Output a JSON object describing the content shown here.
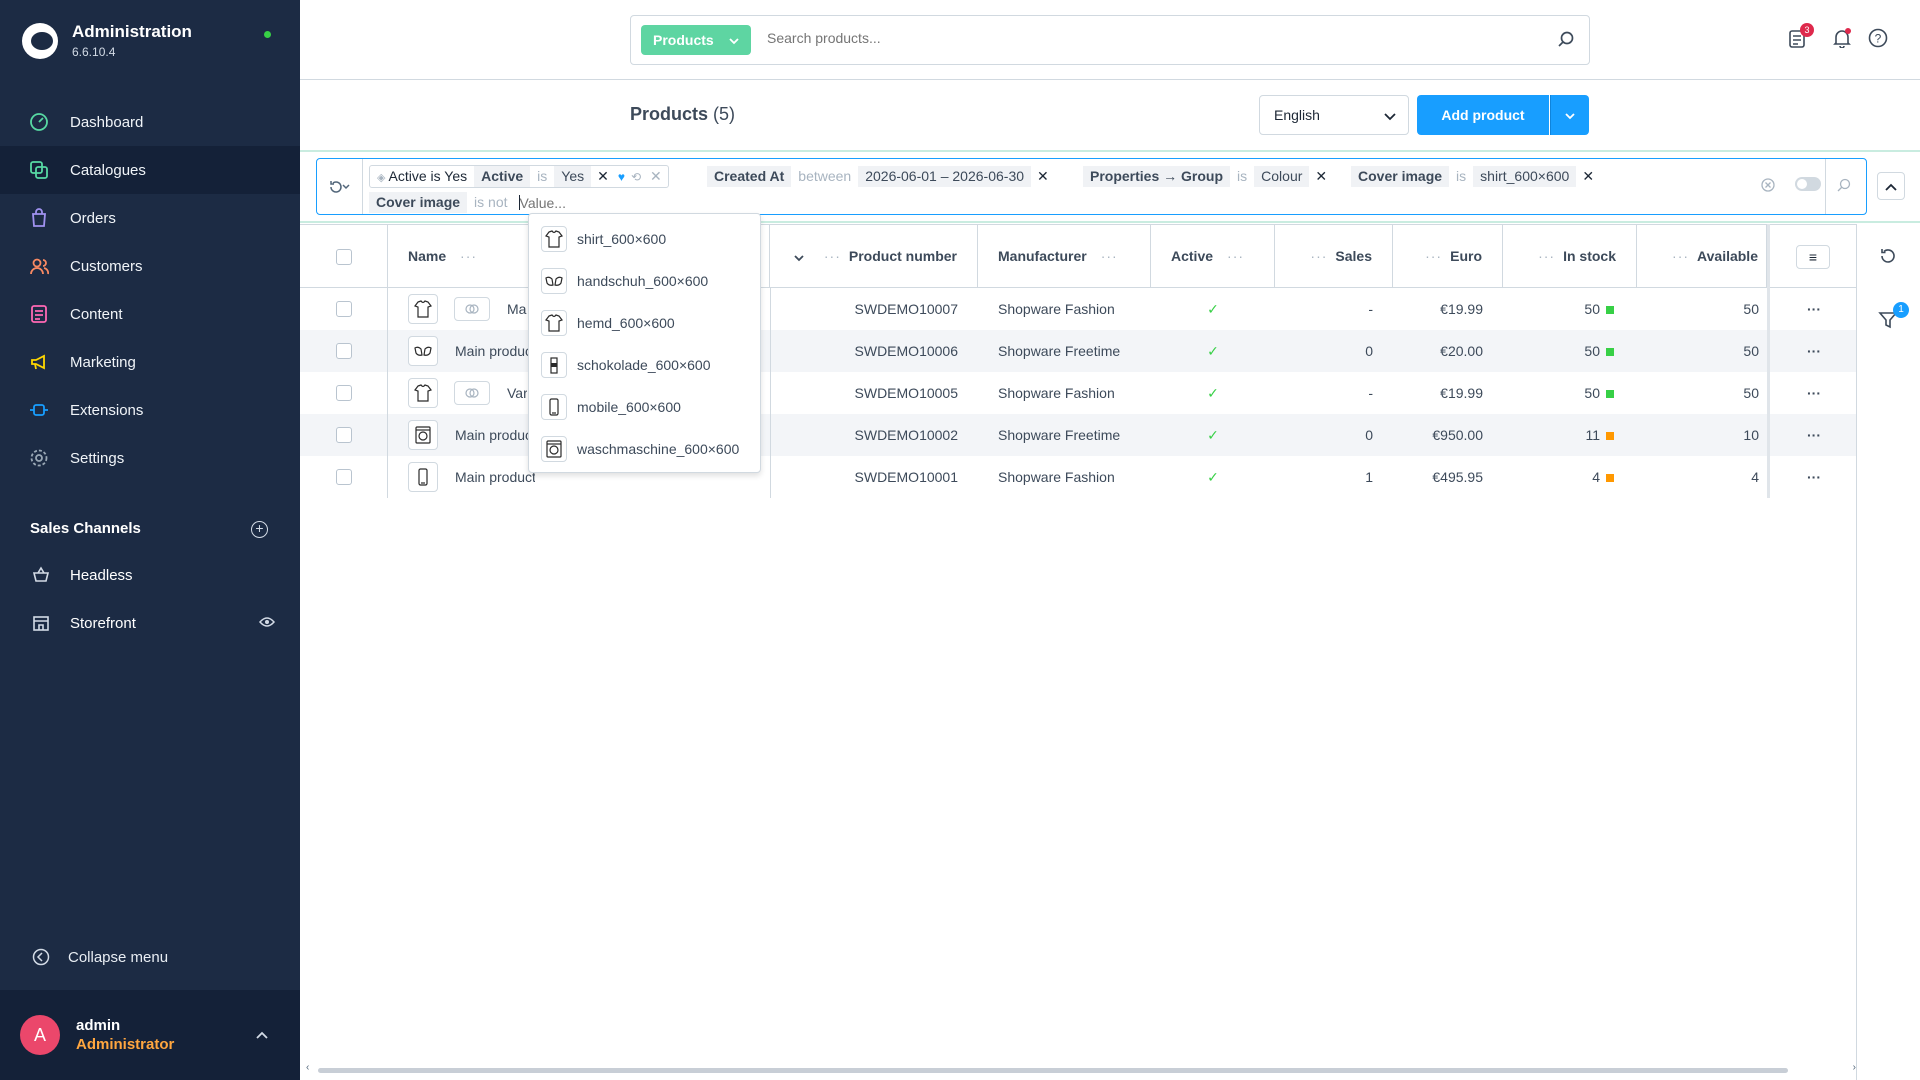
{
  "app": {
    "title": "Administration",
    "version": "6.6.10.4"
  },
  "sidebar": {
    "items": [
      {
        "label": "Dashboard",
        "icon": "dashboard-icon",
        "color": "#57d9a3"
      },
      {
        "label": "Catalogues",
        "icon": "catalogue-icon",
        "color": "#57d9a3",
        "active": true
      },
      {
        "label": "Orders",
        "icon": "orders-icon",
        "color": "#a092f0"
      },
      {
        "label": "Customers",
        "icon": "customers-icon",
        "color": "#f88962"
      },
      {
        "label": "Content",
        "icon": "content-icon",
        "color": "#ff68b4"
      },
      {
        "label": "Marketing",
        "icon": "marketing-icon",
        "color": "#ffd700"
      },
      {
        "label": "Extensions",
        "icon": "extensions-icon",
        "color": "#189eff"
      },
      {
        "label": "Settings",
        "icon": "settings-icon",
        "color": "#9aa8b5"
      }
    ],
    "sales_channels_title": "Sales Channels",
    "sales_channels": [
      {
        "label": "Headless"
      },
      {
        "label": "Storefront"
      }
    ],
    "collapse_label": "Collapse menu",
    "user": {
      "initial": "A",
      "name": "admin",
      "role": "Administrator"
    }
  },
  "header": {
    "search_type": "Products",
    "search_placeholder": "Search products...",
    "notifications_badge": "3",
    "filter_badge": "1"
  },
  "smartbar": {
    "title": "Products",
    "count": "(5)",
    "language": "English",
    "add_label": "Add product"
  },
  "filters": {
    "saved_name": "Active is Yes",
    "chips": [
      {
        "field": "Active",
        "op": "is",
        "value": "Yes"
      },
      {
        "field": "Created At",
        "op": "between",
        "value": "2026-06-01 – 2026-06-30"
      },
      {
        "field": "Properties → Group",
        "op": "is",
        "value": "Colour"
      },
      {
        "field": "Cover image",
        "op": "is",
        "value": "shirt_600×600"
      },
      {
        "field": "Cover image",
        "op": "is not"
      }
    ],
    "value_placeholder": "Value..."
  },
  "table": {
    "headers": {
      "name": "Name",
      "product_number": "Product number",
      "manufacturer": "Manufacturer",
      "active": "Active",
      "sales": "Sales",
      "euro": "Euro",
      "in_stock": "In stock",
      "available": "Available"
    },
    "rows": [
      {
        "name": "Main product with variants",
        "number": "SWDEMO10007",
        "manufacturer": "Shopware Fashion",
        "active": true,
        "sales": "-",
        "price": "€19.99",
        "stock": "50",
        "stock_color": "#37d046",
        "available": "50",
        "thumb": "shirt-icon",
        "variants": true
      },
      {
        "name": "Main product with properties",
        "number": "SWDEMO10006",
        "manufacturer": "Shopware Freetime",
        "active": true,
        "sales": "0",
        "price": "€20.00",
        "stock": "50",
        "stock_color": "#37d046",
        "available": "50",
        "thumb": "glove-icon",
        "variants": false
      },
      {
        "name": "Variant product",
        "number": "SWDEMO10005",
        "manufacturer": "Shopware Fashion",
        "active": true,
        "sales": "-",
        "price": "€19.99",
        "stock": "50",
        "stock_color": "#37d046",
        "available": "50",
        "thumb": "shirt-icon",
        "variants": true
      },
      {
        "name": "Main product with reviews",
        "number": "SWDEMO10002",
        "manufacturer": "Shopware Freetime",
        "active": true,
        "sales": "0",
        "price": "€950.00",
        "stock": "11",
        "stock_color": "#ff9800",
        "available": "10",
        "thumb": "washing-machine-icon",
        "variants": false
      },
      {
        "name": "Main product",
        "number": "SWDEMO10001",
        "manufacturer": "Shopware Fashion",
        "active": true,
        "sales": "1",
        "price": "€495.95",
        "stock": "4",
        "stock_color": "#ff9800",
        "available": "4",
        "thumb": "mobile-icon",
        "variants": false
      }
    ]
  },
  "dropdown": {
    "options": [
      {
        "label": "shirt_600×600",
        "icon": "shirt-icon"
      },
      {
        "label": "handschuh_600×600",
        "icon": "glove-icon"
      },
      {
        "label": "hemd_600×600",
        "icon": "shirt-icon"
      },
      {
        "label": "schokolade_600×600",
        "icon": "chocolate-icon"
      },
      {
        "label": "mobile_600×600",
        "icon": "mobile-icon"
      },
      {
        "label": "waschmaschine_600×600",
        "icon": "washing-machine-icon"
      }
    ]
  }
}
